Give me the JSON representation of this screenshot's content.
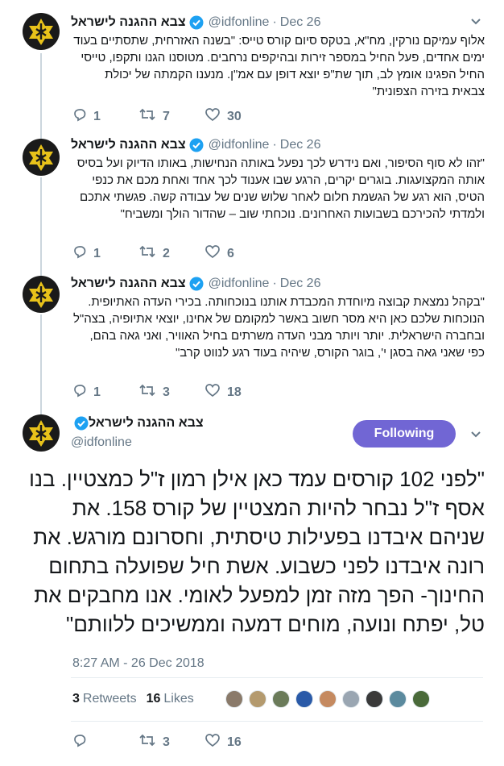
{
  "author": {
    "name": "צבא ההגנה לישראל",
    "handle": "@idfonline"
  },
  "colors": {
    "link": "#1da1f2",
    "muted": "#657786",
    "follow_bg": "#7166d4",
    "avatar_gold": "#e8c21a"
  },
  "tweets": [
    {
      "date": "Dec 26",
      "text": "אלוף עמיקם נורקין, מח\"א, בטקס סיום קורס טייס: \"בשנה האזרחית, שתסתיים בעוד ימים אחדים, פעל החיל במספר זירות ובהיקפים נרחבים. מטוסנו הגנו ותקפו, טייסי החיל הפגינו אומץ לב, תוך שת\"פ יוצא דופן עם אמ\"ן. מנענו הקמתה של יכולת צבאית בזירה הצפונית\"",
      "replies": "1",
      "retweets": "7",
      "likes": "30"
    },
    {
      "date": "Dec 26",
      "text": "\"זהו לא סוף הסיפור, ואם נידרש לכך נפעל באותה הנחישות, באותו הדיוק ועל בסיס אותה המקצועגות. בוגרים יקרים, הרגע שבו אענוד לכך אחד ואחת מכם את כנפי הטיס, הוא רגע של הגשמת חלום לאחר שלוש שנים של עבודה קשה. פגשתי אתכם ולמדתי להכירכם בשבועות האחרונים. נוכחתי שוב – שהדור הולך ומשביח\"",
      "replies": "1",
      "retweets": "2",
      "likes": "6"
    },
    {
      "date": "Dec 26",
      "text": "\"בקהל נמצאת קבוצה מיוחדת המכבדת אותנו בנוכחותה. בכירי העדה האתיופית. הנוכחות שלכם כאן היא מסר חשוב באשר למקומם של אחינו, יוצאי אתיופיה, בצה\"ל ובחברה הישראלית. יותר ויותר מבני העדה משרתים בחיל האוויר, ואני גאה בהם, כפי שאני גאה בסגן י', בוגר הקורס, שיהיה בעוד רגע לנווט קרב\"",
      "replies": "1",
      "retweets": "3",
      "likes": "18"
    }
  ],
  "main_tweet": {
    "follow_label": "Following",
    "text": "\"לפני 102 קורסים עמד כאן אילן רמון ז\"ל כמצטיין. בנו אסף ז\"ל נבחר להיות המצטיין של קורס 158. את שניהם איבדנו בפעילות טיסתית, וחסרונם מורגש. את רונה איבדנו לפני כשבוע. אשת חיל שפועלה בתחום החינוך- הפך מזה זמן למפעל לאומי. אנו מחבקים את טל, יפתח ונועה, מוחים דמעה וממשיכים ללוותם\"",
    "timestamp": "8:27 AM - 26 Dec 2018",
    "retweets_count": "3",
    "retweets_label": "Retweets",
    "likes_count": "16",
    "likes_label": "Likes",
    "replies": "",
    "retweets": "3",
    "likes": "16",
    "liker_colors": [
      "#8a7a6a",
      "#b49a6e",
      "#6b7b5a",
      "#2a5aa8",
      "#c58a60",
      "#9aa6b2",
      "#3a3a3a",
      "#5b8a9e",
      "#4a6a3a"
    ]
  }
}
